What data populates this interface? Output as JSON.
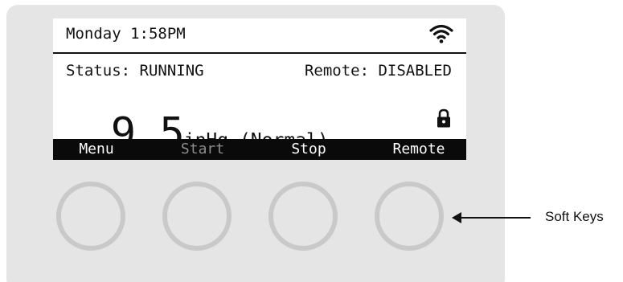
{
  "screen": {
    "datetime": "Monday 1:58PM",
    "status_text": "Status: RUNNING",
    "remote_text": "Remote: DISABLED",
    "reading_value": "9.5",
    "reading_unit": "inHg (Normal)",
    "icons": {
      "wifi": "wifi-icon",
      "lock": "lock-icon"
    }
  },
  "softkeys": [
    {
      "label": "Menu",
      "enabled": true
    },
    {
      "label": "Start",
      "enabled": false
    },
    {
      "label": "Stop",
      "enabled": true
    },
    {
      "label": "Remote",
      "enabled": true
    }
  ],
  "callout": {
    "label": "Soft Keys"
  },
  "colors": {
    "panel": "#e5e5e5",
    "screen_bg": "#ffffff",
    "softbar_bg": "#0a0a0a",
    "disabled_label": "#8e8e8e",
    "knob_ring": "#c9c9c9"
  }
}
